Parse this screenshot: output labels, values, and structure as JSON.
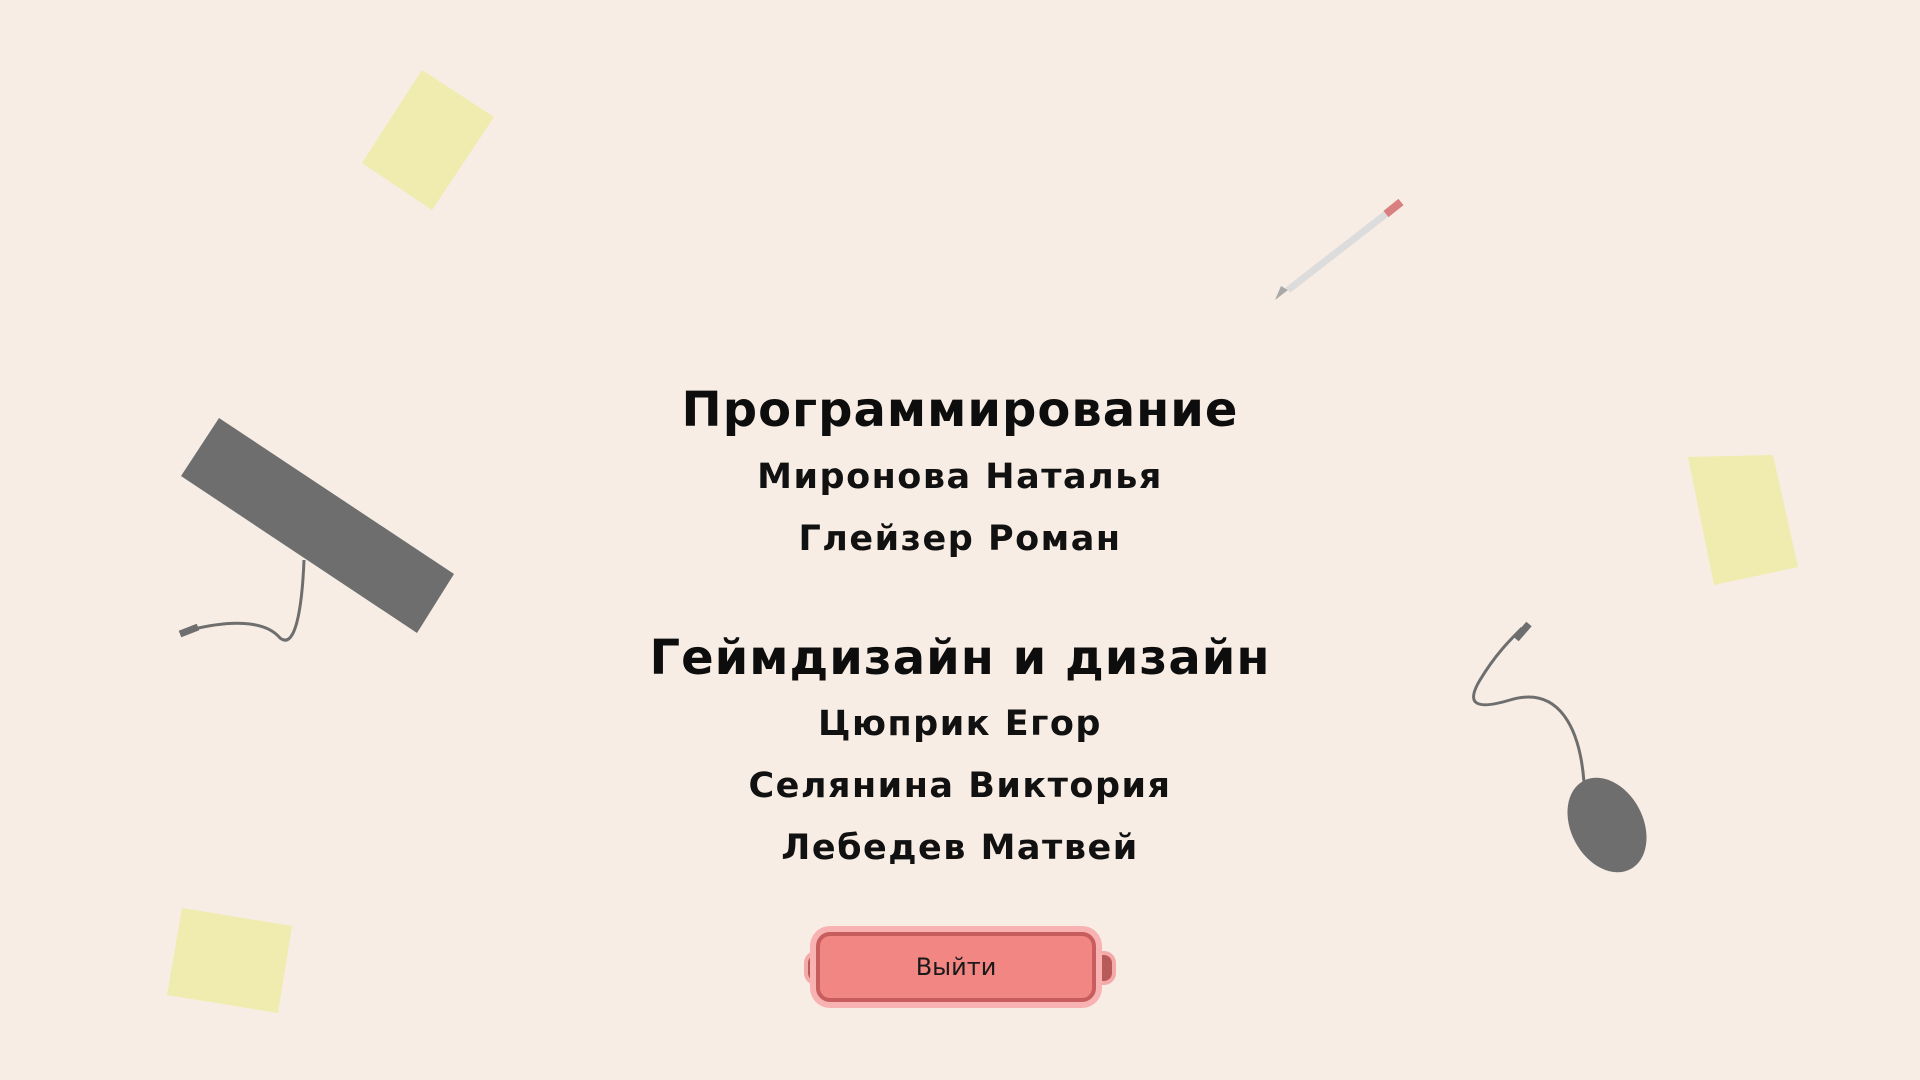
{
  "sections": [
    {
      "title": "Программирование",
      "people": [
        "Миронова Наталья",
        "Глейзер Роман"
      ]
    },
    {
      "title": "Геймдизайн и дизайн",
      "people": [
        "Цюприк Егор",
        "Селянина Виктория",
        "Лебедев Матвей"
      ]
    }
  ],
  "exit_button": {
    "label": "Выйти"
  },
  "colors": {
    "background": "#f7ede4",
    "sticky_note": "#f0ebae",
    "keyboard": "#6e6e6e",
    "mouse": "#6e6e6e",
    "pencil_body": "#dcdcdc",
    "pencil_eraser": "#d97f7f",
    "exit_button_fill": "#f28683",
    "exit_button_border": "#c75d5d"
  },
  "icons": [
    "sticky-note-icon",
    "keyboard-icon",
    "mouse-icon",
    "pencil-icon"
  ]
}
